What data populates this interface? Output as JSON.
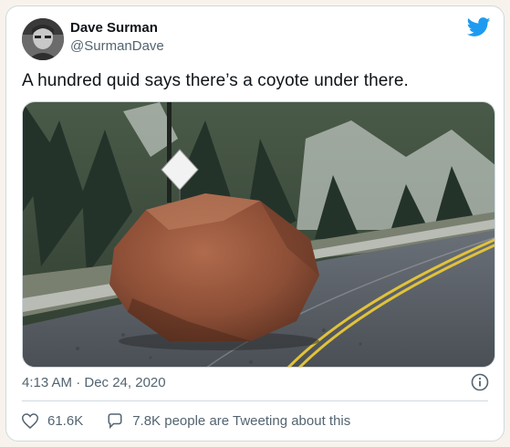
{
  "tweet": {
    "author": {
      "display_name": "Dave Surman",
      "handle": "@SurmanDave"
    },
    "text": "A hundred quid says there’s a coyote under there.",
    "timestamp": "4:13 AM · Dec 24, 2020",
    "likes": "61.6K",
    "retweets_text": "7.8K people are Tweeting about this"
  },
  "colors": {
    "brand": "#1d9bf0",
    "secondary_text": "#536471",
    "primary_text": "#0f1419",
    "border": "#cfd9de"
  },
  "icons": {
    "brand": "twitter-bird-icon",
    "info": "info-icon",
    "like": "heart-icon",
    "reply": "speech-bubble-icon"
  }
}
